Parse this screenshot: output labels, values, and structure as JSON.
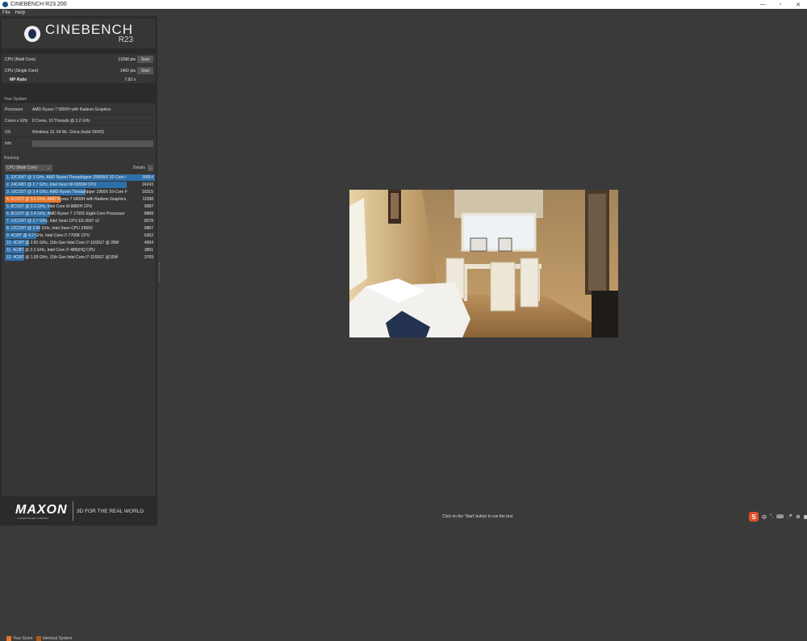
{
  "window": {
    "title": "CINEBENCH R23.200",
    "controls": [
      "—",
      "▫",
      "✕"
    ]
  },
  "menu": [
    "File",
    "Help"
  ],
  "logo": {
    "name": "CINEBENCH",
    "version": "R23"
  },
  "benchmarks": [
    {
      "label": "CPU (Multi Core)",
      "value": "11098 pts",
      "button": "Start"
    },
    {
      "label": "CPU (Single Core)",
      "value": "1402 pts",
      "button": "Start"
    },
    {
      "label": "MP Ratio",
      "value": "7.92 x"
    }
  ],
  "your_system": {
    "title": "Your System",
    "rows": [
      {
        "key": "Processor",
        "value": "AMD Ryzen 7 5800H with Radeon Graphics"
      },
      {
        "key": "Cores x GHz",
        "value": "8 Cores, 16 Threads @ 3.2 GHz"
      },
      {
        "key": "OS",
        "value": "Windows 10, 64 Bit, China (build 19043)"
      },
      {
        "key": "Info",
        "value": ""
      }
    ]
  },
  "ranking": {
    "title": "Ranking",
    "dropdown": "CPU (Multi Core)",
    "details": "Details",
    "rows": [
      {
        "text": "1. 32C/64T @ 3 GHz, AMD Ryzen Threadripper 2990WX 32-Core I",
        "score": "30054",
        "fraction": 1.0,
        "highlight": false
      },
      {
        "text": "2. 24C/48T @ 2.7 GHz, Intel Xeon W-3265M CPU",
        "score": "24243",
        "fraction": 0.81,
        "highlight": false
      },
      {
        "text": "3. 16C/32T @ 3.4 GHz, AMD Ryzen Threadripper 1950X 16-Core F",
        "score": "16315",
        "fraction": 0.54,
        "highlight": false
      },
      {
        "text": "4. 8C/16T @ 3.2 GHz, AMD Ryzen 7 5800H with Radeon Graphics",
        "score": "11098",
        "fraction": 0.37,
        "highlight": true
      },
      {
        "text": "5. 8C/16T @ 2.3 GHz, Intel Core i9-9880H CPU",
        "score": "9087",
        "fraction": 0.3,
        "highlight": false
      },
      {
        "text": "6. 8C/16T @ 3.4 GHz, AMD Ryzen 7 1700X Eight-Core Processor",
        "score": "8889",
        "fraction": 0.3,
        "highlight": false
      },
      {
        "text": "7. 12C/24T @ 2.7 GHz, Intel Xeon CPU E5-2697 v2",
        "score": "8378",
        "fraction": 0.28,
        "highlight": false
      },
      {
        "text": "8. 12C/24T @ 2.66 GHz, Intel Xeon CPU X5650",
        "score": "6867",
        "fraction": 0.23,
        "highlight": false
      },
      {
        "text": "9. 4C/8T @ 4.2 GHz, Intel Core i7-7700K CPU",
        "score": "6302",
        "fraction": 0.21,
        "highlight": false
      },
      {
        "text": "10. 4C/8T @ 2.81 GHz, 11th Gen Intel Core i7-1165G7 @ 28W",
        "score": "4904",
        "fraction": 0.16,
        "highlight": false
      },
      {
        "text": "11. 4C/8T @ 2.3 GHz, Intel Core i7-4850HQ CPU",
        "score": "3891",
        "fraction": 0.13,
        "highlight": false
      },
      {
        "text": "12. 4C/8T @ 1.69 GHz, 11th Gen Intel Core i7-1165G7 @15W",
        "score": "3769",
        "fraction": 0.13,
        "highlight": false
      }
    ],
    "colors": {
      "bar": "#2d6fa8",
      "highlight": "#e8762b"
    }
  },
  "legend": [
    {
      "label": "Your Score",
      "color": "#e8762b"
    },
    {
      "label": "Identical System",
      "color": "#b05a1e"
    }
  ],
  "brand": {
    "name": "MAXON",
    "subtitle": "A NEMETSCHEK COMPANY",
    "slogan": "3D FOR THE REAL WORLD"
  },
  "status_text": "Click on the 'Start' button to run the test.",
  "tray": {
    "ime": "S",
    "icons": [
      "中",
      "°,",
      "⌨",
      "🎤",
      "⚙",
      "▦"
    ]
  }
}
